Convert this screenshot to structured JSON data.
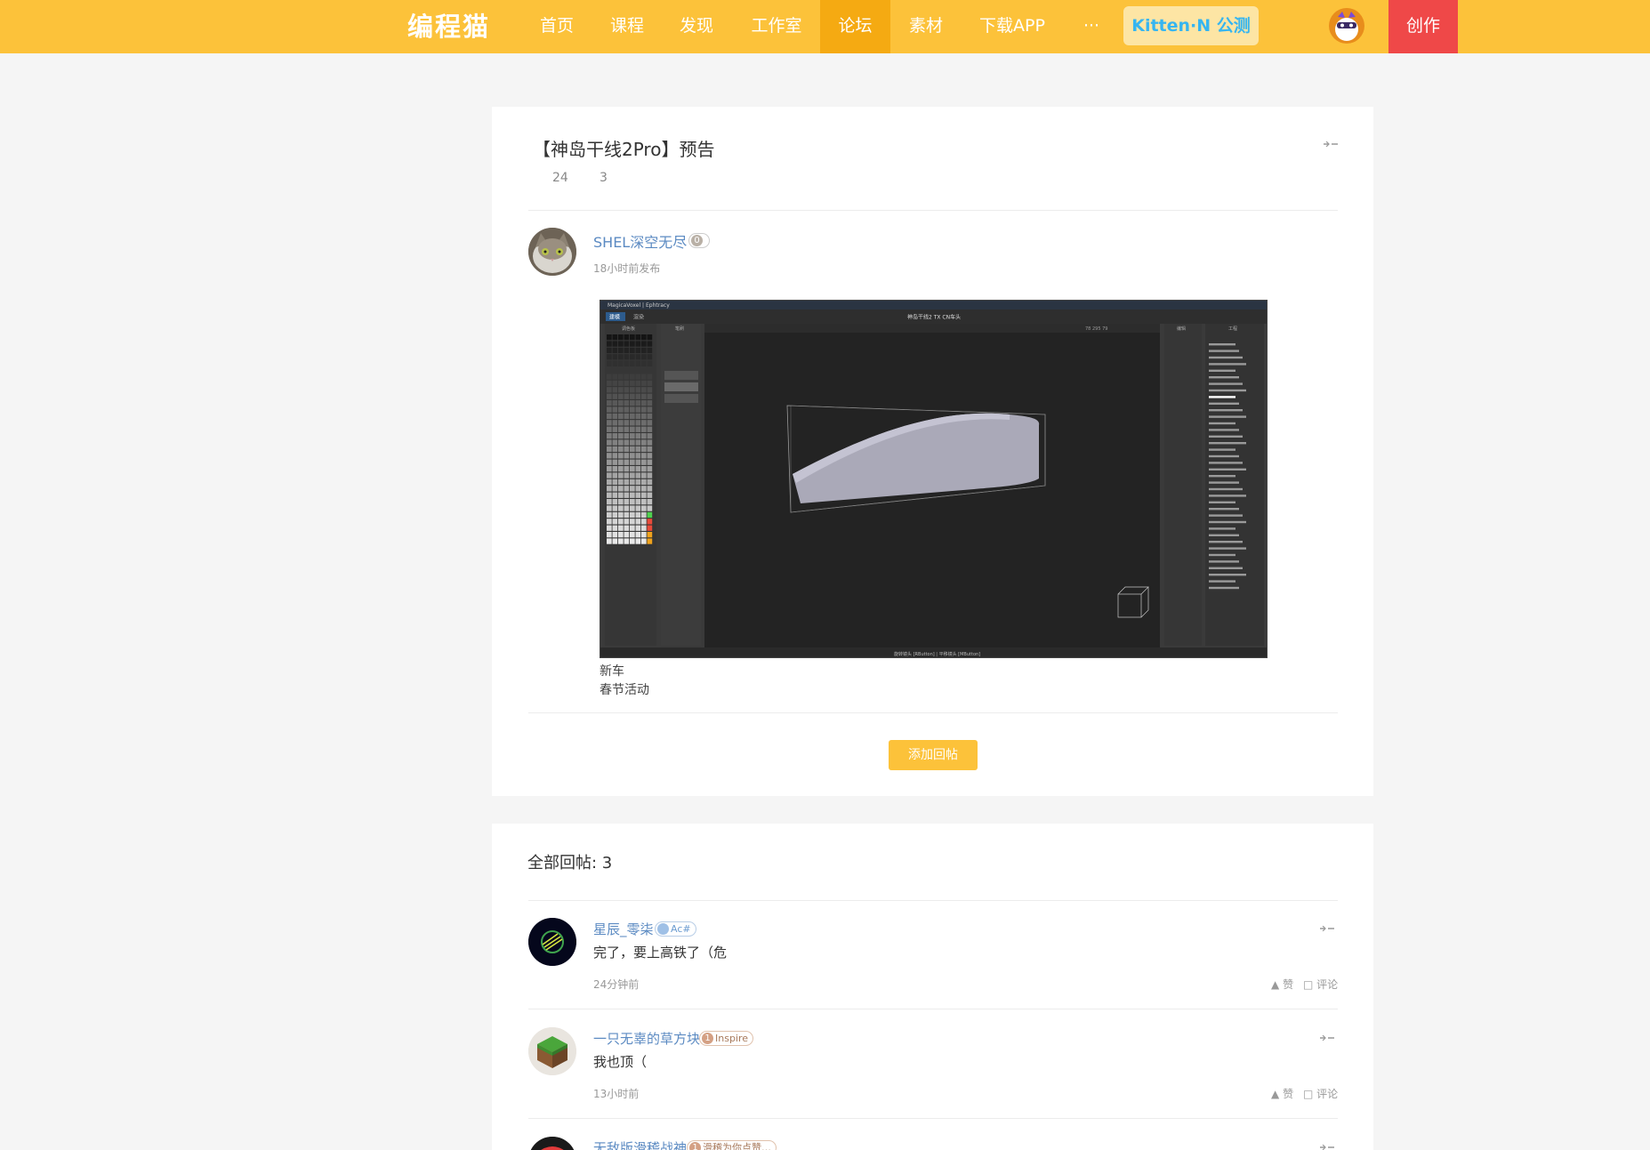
{
  "nav": {
    "logo": "编程猫",
    "items": [
      "首页",
      "课程",
      "发现",
      "工作室",
      "论坛",
      "素材",
      "下载APP",
      "···"
    ],
    "active_index": 4,
    "kitten_label": "Kitten·N 公测",
    "create_label": "创作",
    "colors": {
      "bar": "#fcc23a",
      "active": "#f5aa12",
      "create": "#ef4848"
    }
  },
  "post": {
    "title": "【神岛干线2Pro】预告",
    "views": "24",
    "replies": "3",
    "author": "SHEL深空无尽",
    "author_level": "0",
    "time": "18小时前发布",
    "screenshot": {
      "window_title": "MagicaVoxel | Ephtracy",
      "tabs": [
        "建模",
        "渲染"
      ],
      "doc_title": "神岛干线2 TX CN车头",
      "panel_palette": "调色板",
      "panel_brush": "笔刷",
      "panel_edit": "编辑",
      "panel_world": "工程",
      "status": "旋转镜头 [RButton] | 平移镜头 [MButton]",
      "coords": "78 295 79"
    },
    "lines": [
      "新车",
      "春节活动"
    ],
    "reply_button": "添加回帖"
  },
  "replies": {
    "heading": "全部回帖: 3",
    "like_label": "赞",
    "comment_label": "评论",
    "items": [
      {
        "name": "星辰_零柒",
        "badge": "Ac#",
        "text": "完了，要上高铁了（危",
        "time": "24分钟前"
      },
      {
        "name": "一只无辜的草方块",
        "badge": "Inspire",
        "badge_num": "1",
        "text": "我也顶（",
        "time": "13小时前"
      },
      {
        "name": "无敌版滑稽战神",
        "badge": "滑稽为你点赞…",
        "badge_num": "1"
      }
    ]
  }
}
